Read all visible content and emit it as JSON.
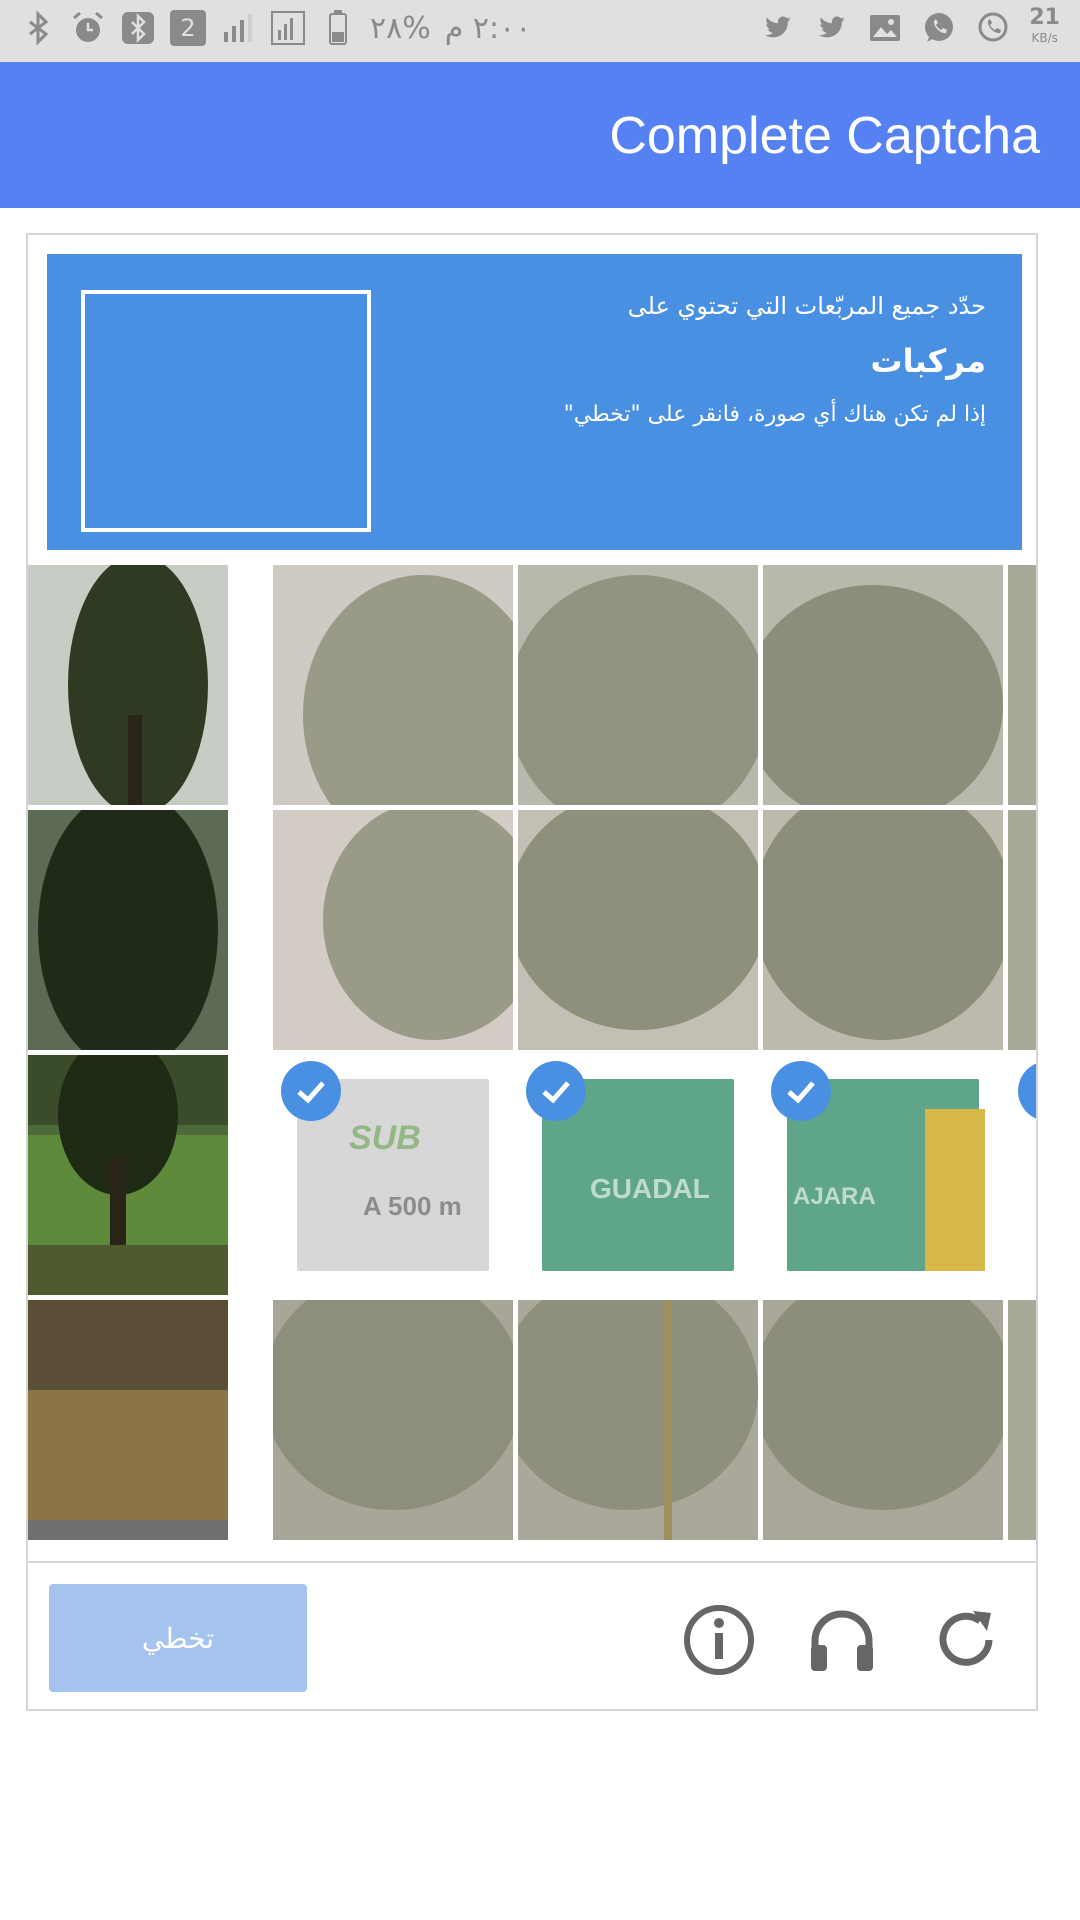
{
  "status_bar": {
    "time": "٢:٠٠ م",
    "battery": "%٢٨",
    "sim": "2",
    "net_speed": "21",
    "net_unit": "KB/s"
  },
  "app_bar": {
    "title": "Complete Captcha"
  },
  "captcha": {
    "instruction": "حدّد جميع المربّعات التي تحتوي على",
    "target": "مركبات",
    "hint": "إذا لم تكن هناك أي صورة، فانقر على \"تخطي\"",
    "sign_texts": {
      "subway": "SUB",
      "distance": "A 500 m",
      "guadal": "GUADAL",
      "ajara": "AJARA"
    },
    "skip_label": "تخطي",
    "accent": "#4a90e2",
    "icons": [
      "info-icon",
      "headphones-icon",
      "reload-icon"
    ]
  }
}
